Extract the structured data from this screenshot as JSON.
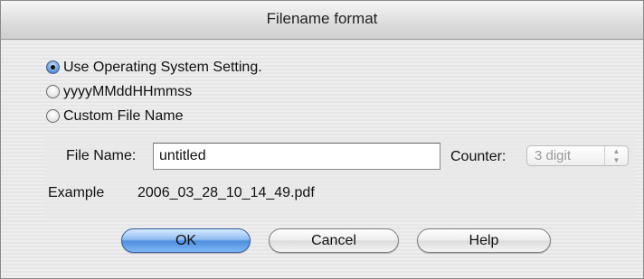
{
  "dialog": {
    "title": "Filename format"
  },
  "format_options": [
    {
      "label": "Use Operating System Setting.",
      "selected": true
    },
    {
      "label": "yyyyMMddHHmmss",
      "selected": false
    },
    {
      "label": "Custom File Name",
      "selected": false
    }
  ],
  "file_name": {
    "label": "File Name:",
    "value": "untitled"
  },
  "counter": {
    "label": "Counter:",
    "selected": "3 digit",
    "enabled": false
  },
  "example": {
    "label": "Example",
    "value": "2006_03_28_10_14_49.pdf"
  },
  "buttons": {
    "ok": "OK",
    "cancel": "Cancel",
    "help": "Help"
  },
  "colors": {
    "default_button": "#4f8fe0",
    "radio_selected": "#5b8fd6"
  }
}
